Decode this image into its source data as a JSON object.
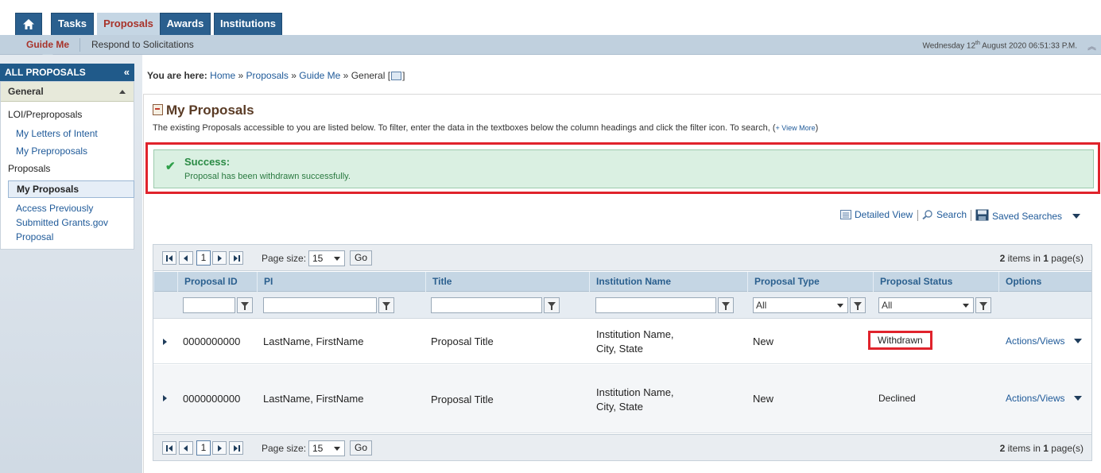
{
  "topnav": {
    "tabs": [
      {
        "label": "Tasks"
      },
      {
        "label": "Proposals"
      },
      {
        "label": "Awards"
      },
      {
        "label": "Institutions"
      }
    ]
  },
  "subnav": {
    "items": [
      "Guide Me",
      "Respond to Solicitations"
    ],
    "datetime_day": "Wednesday 12",
    "datetime_sup": "th",
    "datetime_rest": " August 2020 06:51:33 P.M."
  },
  "sidebar": {
    "title": "ALL PROPOSALS",
    "collapse_glyph": "«",
    "group": "General",
    "sections": [
      {
        "label": "LOI/Preproposals"
      },
      {
        "label": "Proposals"
      }
    ],
    "links": [
      "My Letters of Intent",
      "My Preproposals",
      "My Proposals",
      "Access Previously",
      "Submitted Grants.gov",
      "Proposal"
    ]
  },
  "breadcrumb": {
    "prefix": "You are here:",
    "home": "Home",
    "proposals": "Proposals",
    "guide_me": "Guide Me",
    "current": "General [",
    "close": "]",
    "sep": "»"
  },
  "page": {
    "title": "My Proposals",
    "intro": "The existing Proposals accessible to you are listed below. To filter, enter the data in the textboxes below the column headings and click the filter icon. To search, (",
    "intro_link": "+ View More",
    "intro_close": ")"
  },
  "success": {
    "title": "Success:",
    "message": "Proposal has been withdrawn successfully."
  },
  "tools": {
    "detailed_view": "Detailed View",
    "search": "Search",
    "saved_searches": "Saved Searches"
  },
  "pager": {
    "page": "1",
    "size_label": "Page size:",
    "size_value": "15",
    "go": "Go",
    "items_count": "2",
    "items_text": " items in ",
    "pages_count": "1",
    "pages_text": " page(s)"
  },
  "grid": {
    "columns": [
      "Proposal ID",
      "PI",
      "Title",
      "Institution Name",
      "Proposal Type",
      "Proposal Status",
      "Options"
    ],
    "filter_all": "All",
    "rows": [
      {
        "id": "0000000000",
        "pi": "LastName, FirstName",
        "title": "Proposal Title",
        "inst1": "Institution Name,",
        "inst2": "City, State",
        "type": "New",
        "status": "Withdrawn",
        "actions": "Actions/Views"
      },
      {
        "id": "0000000000",
        "pi": "LastName, FirstName",
        "title": "Proposal Title",
        "inst1": "Institution Name,",
        "inst2": "City, State",
        "type": "New",
        "status": "Declined",
        "actions": "Actions/Views"
      }
    ]
  },
  "colors": {
    "nav_blue": "#2a5f8e",
    "active_tab_text": "#a8332a",
    "highlight_red": "#e0232c",
    "success_green": "#2a8a44"
  }
}
